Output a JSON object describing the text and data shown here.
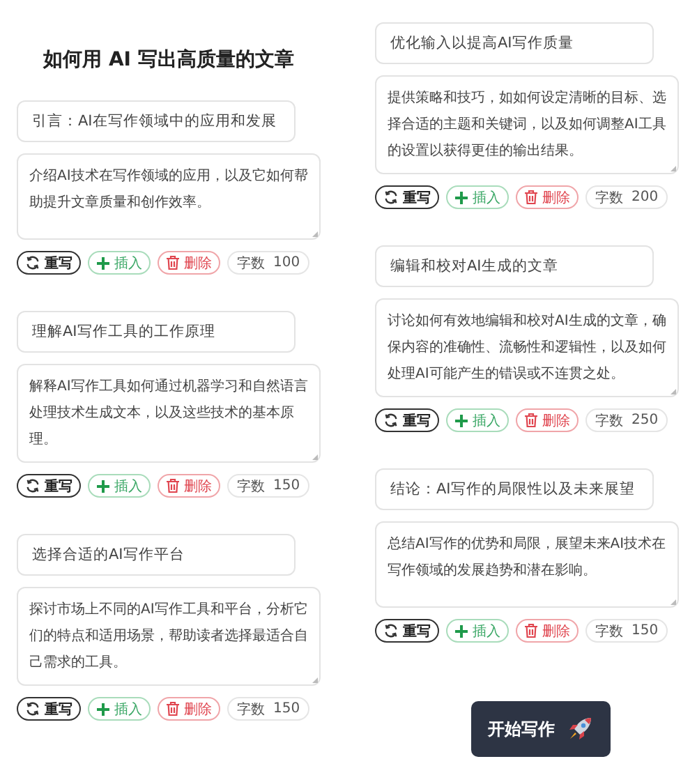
{
  "heading": "如何用 AI 写出高质量的文章",
  "left_column": [
    {
      "title": "引言：AI在写作领域中的应用和发展",
      "description": "介绍AI技术在写作领域的应用，以及它如何帮助提升文章质量和创作效率。",
      "actions": [
        {
          "kind": "rewrite",
          "label": "重写"
        },
        {
          "kind": "insert",
          "label": "插入"
        },
        {
          "kind": "delete",
          "label": "删除"
        }
      ],
      "word_count_label": "字数",
      "word_count": "100"
    },
    {
      "title": "理解AI写作工具的工作原理",
      "description": "解释AI写作工具如何通过机器学习和自然语言处理技术生成文本，以及这些技术的基本原理。",
      "actions": [
        {
          "kind": "rewrite",
          "label": "重写"
        },
        {
          "kind": "insert",
          "label": "插入"
        },
        {
          "kind": "delete",
          "label": "删除"
        }
      ],
      "word_count_label": "字数",
      "word_count": "150"
    },
    {
      "title": "选择合适的AI写作平台",
      "description": "探讨市场上不同的AI写作工具和平台，分析它们的特点和适用场景，帮助读者选择最适合自己需求的工具。",
      "actions": [
        {
          "kind": "rewrite",
          "label": "重写"
        },
        {
          "kind": "insert",
          "label": "插入"
        },
        {
          "kind": "delete",
          "label": "删除"
        }
      ],
      "word_count_label": "字数",
      "word_count": "150"
    }
  ],
  "right_column": [
    {
      "title": "优化输入以提高AI写作质量",
      "description": "提供策略和技巧，如如何设定清晰的目标、选择合适的主题和关键词，以及如何调整AI工具的设置以获得更佳的输出结果。",
      "actions": [
        {
          "kind": "rewrite",
          "label": "重写"
        },
        {
          "kind": "insert",
          "label": "插入"
        },
        {
          "kind": "delete",
          "label": "删除"
        }
      ],
      "word_count_label": "字数",
      "word_count": "200"
    },
    {
      "title": "编辑和校对AI生成的文章",
      "description": "讨论如何有效地编辑和校对AI生成的文章，确保内容的准确性、流畅性和逻辑性，以及如何处理AI可能产生的错误或不连贯之处。",
      "actions": [
        {
          "kind": "rewrite",
          "label": "重写"
        },
        {
          "kind": "insert",
          "label": "插入"
        },
        {
          "kind": "delete",
          "label": "删除"
        }
      ],
      "word_count_label": "字数",
      "word_count": "250"
    },
    {
      "title": "结论：AI写作的局限性以及未来展望",
      "description": "总结AI写作的优势和局限，展望未来AI技术在写作领域的发展趋势和潜在影响。",
      "actions": [
        {
          "kind": "rewrite",
          "label": "重写"
        },
        {
          "kind": "insert",
          "label": "插入"
        },
        {
          "kind": "delete",
          "label": "删除"
        }
      ],
      "word_count_label": "字数",
      "word_count": "150"
    }
  ],
  "start_button": {
    "label": "开始写作"
  }
}
